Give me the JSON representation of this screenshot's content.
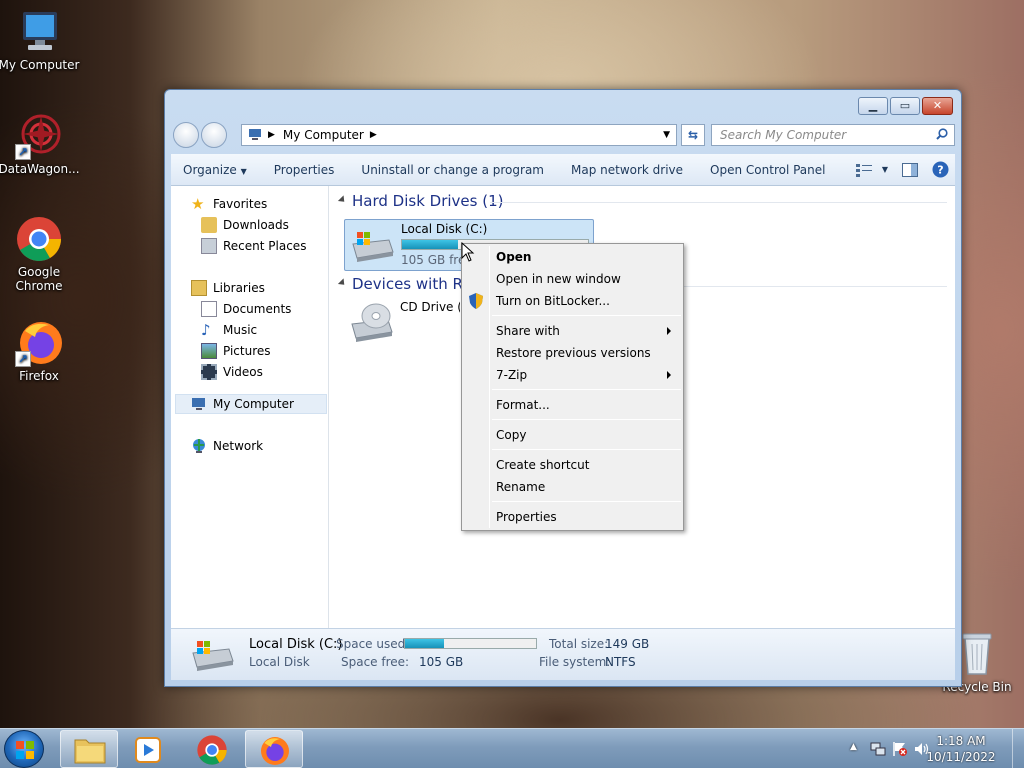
{
  "desktop": {
    "icons": [
      {
        "label": "My Computer"
      },
      {
        "label": "DataWagon..."
      },
      {
        "label": "Google Chrome"
      },
      {
        "label": "Firefox"
      },
      {
        "label": "Recycle Bin"
      }
    ]
  },
  "window": {
    "address": "My Computer",
    "search_placeholder": "Search My Computer",
    "toolbar": {
      "organize": "Organize",
      "properties": "Properties",
      "uninstall": "Uninstall or change a program",
      "map_drive": "Map network drive",
      "control_panel": "Open Control Panel"
    },
    "nav": {
      "favorites": "Favorites",
      "downloads": "Downloads",
      "recent": "Recent Places",
      "libraries": "Libraries",
      "documents": "Documents",
      "music": "Music",
      "pictures": "Pictures",
      "videos": "Videos",
      "computer": "My Computer",
      "network": "Network"
    },
    "groups": {
      "hdd": "Hard Disk Drives (1)",
      "removable": "Devices with Removable Storage (1)"
    },
    "drives": {
      "c_name": "Local Disk (C:)",
      "c_free": "105 GB free of 149 GB",
      "c_used_fraction": 0.3,
      "cd_name": "CD Drive (D:)"
    },
    "details": {
      "name": "Local Disk (C:)",
      "type": "Local Disk",
      "space_used_label": "Space used:",
      "space_free_label": "Space free:",
      "space_free": "105 GB",
      "total_label": "Total size:",
      "total": "149 GB",
      "fs_label": "File system:",
      "fs": "NTFS"
    }
  },
  "context_menu": {
    "open": "Open",
    "open_new": "Open in new window",
    "bitlocker": "Turn on BitLocker...",
    "share": "Share with",
    "restore": "Restore previous versions",
    "zip": "7-Zip",
    "format": "Format...",
    "copy": "Copy",
    "shortcut": "Create shortcut",
    "rename": "Rename",
    "properties": "Properties"
  },
  "taskbar": {
    "time": "1:18 AM",
    "date": "10/11/2022"
  }
}
